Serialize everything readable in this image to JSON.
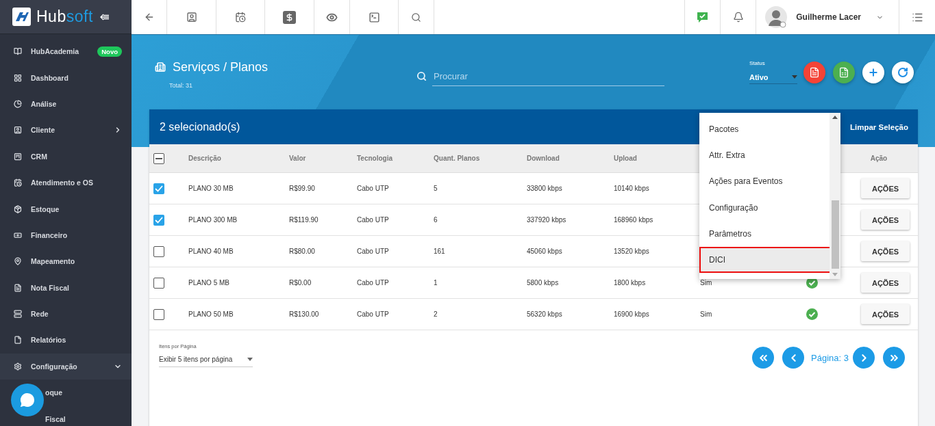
{
  "logo": {
    "part_1": "Hub",
    "part_2": "soft"
  },
  "sidebar": {
    "items": [
      {
        "kind": "plain",
        "label": "HubAcademia",
        "badge": "Novo"
      },
      {
        "kind": "plain",
        "label": "Dashboard"
      },
      {
        "kind": "plain",
        "label": "Análise"
      },
      {
        "kind": "submenu",
        "label": "Cliente",
        "expanded": false
      },
      {
        "kind": "plain",
        "label": "CRM"
      },
      {
        "kind": "plain",
        "label": "Atendimento e OS"
      },
      {
        "kind": "plain",
        "label": "Estoque"
      },
      {
        "kind": "plain",
        "label": "Financeiro"
      },
      {
        "kind": "plain",
        "label": "Mapeamento"
      },
      {
        "kind": "plain",
        "label": "Nota Fiscal"
      },
      {
        "kind": "plain",
        "label": "Rede"
      },
      {
        "kind": "plain",
        "label": "Relatórios"
      },
      {
        "kind": "submenu",
        "label": "Configuração",
        "expanded": true,
        "children": [
          {
            "label": "oque"
          },
          {
            "label": "Fiscal"
          }
        ]
      }
    ]
  },
  "topbar": {
    "user_name": "Guilherme Lacer"
  },
  "page": {
    "title": "Serviços / Planos",
    "total": "Total: 31",
    "search": {
      "placeholder": "Procurar"
    },
    "status": {
      "label": "Status",
      "value": "Ativo"
    }
  },
  "selection_bar": {
    "text": "2 selecionado(s)",
    "clear": "Limpar Seleção"
  },
  "table": {
    "select_all_partial": true,
    "columns": [
      "Descrição",
      "Valor",
      "Tecnologia",
      "Quant. Planos",
      "Download",
      "Upload"
    ],
    "action_column": "Ação",
    "rows": [
      {
        "checked": true,
        "cells": [
          "PLANO 30 MB",
          "R$99.90",
          "Cabo UTP",
          "5",
          "33800 kbps",
          "10140 kbps"
        ],
        "action": "AÇÕES"
      },
      {
        "checked": true,
        "cells": [
          "PLANO 300 MB",
          "R$119.90",
          "Cabo UTP",
          "6",
          "337920 kbps",
          "168960 kbps"
        ],
        "action": "AÇÕES"
      },
      {
        "checked": false,
        "cells": [
          "PLANO 40 MB",
          "R$80.00",
          "Cabo UTP",
          "161",
          "45060 kbps",
          "13520 kbps"
        ],
        "action": "AÇÕES"
      },
      {
        "checked": false,
        "cells": [
          "PLANO 5 MB",
          "R$0.00",
          "Cabo UTP",
          "1",
          "5800 kbps",
          "1800 kbps"
        ],
        "column_8": "Sim",
        "column_9_ok": true,
        "action": "AÇÕES"
      },
      {
        "checked": false,
        "cells": [
          "PLANO 50 MB",
          "R$130.00",
          "Cabo UTP",
          "2",
          "56320 kbps",
          "16900 kbps"
        ],
        "column_8": "Sim",
        "column_9_ok": true,
        "action": "AÇÕES"
      }
    ]
  },
  "dropdown": {
    "items": [
      {
        "label": "Pacotes",
        "selected": false
      },
      {
        "label": "Attr. Extra",
        "selected": false
      },
      {
        "label": "Ações para Eventos",
        "selected": false
      },
      {
        "label": "Configuração",
        "selected": false
      },
      {
        "label": "Parâmetros",
        "selected": false
      },
      {
        "label": "DICI",
        "selected": true
      }
    ]
  },
  "footer": {
    "per_page_label": "Itens por Página",
    "per_page_value": "Exibir 5 itens por página",
    "page": "Página: 3"
  }
}
